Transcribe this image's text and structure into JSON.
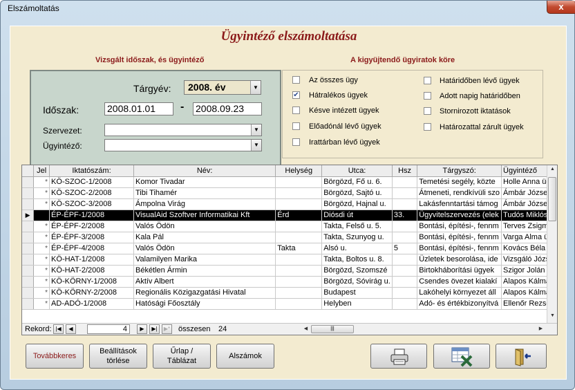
{
  "window": {
    "title": "Elszámoltatás",
    "close": "x"
  },
  "heading": "Ügyintéző elszámoltatása",
  "left_section": {
    "label": "Vizsgált időszak, és ügyintéző",
    "year_label": "Tárgyév:",
    "year_value": "2008. év",
    "period_label": "Időszak:",
    "period_from": "2008.01.01",
    "period_dash": "-",
    "period_to": "2008.09.23",
    "org_label": "Szervezet:",
    "org_value": "",
    "clerk_label": "Ügyintéző:",
    "clerk_value": ""
  },
  "right_section": {
    "label": "A kigyüjtendő ügyiratok köre",
    "options": [
      {
        "label": "Az összes ügy",
        "checked": false
      },
      {
        "label": "Hátralékos ügyek",
        "checked": true
      },
      {
        "label": "Késve intézett ügyek",
        "checked": false
      },
      {
        "label": "Előadónál lévő ügyek",
        "checked": false
      },
      {
        "label": "Irattárban lévő ügyek",
        "checked": false
      },
      {
        "label": "Határidőben lévő ügyek",
        "checked": false
      },
      {
        "label": "Adott napig határidőben",
        "checked": false
      },
      {
        "label": "Stornirozott iktatások",
        "checked": false
      },
      {
        "label": "Határozattal zárult ügyek",
        "checked": false
      }
    ]
  },
  "grid": {
    "columns": [
      "Jel",
      "Iktatószám:",
      "Név:",
      "Helység",
      "Utca:",
      "Hsz",
      "Tárgyszó:",
      "Ügyintéző"
    ],
    "rows": [
      [
        "*",
        "KÖ-SZOC-1/2008",
        "Komor Tivadar",
        "",
        "Börgözd, Fő u. 6.",
        "",
        "Temetési segély, közte",
        "Holle Anna ügy"
      ],
      [
        "*",
        "KÖ-SZOC-2/2008",
        "Tibi Tihamér",
        "",
        "Börgözd, Sajtó u.",
        "",
        "Átmeneti, rendkívüli szo",
        "Ámbár József"
      ],
      [
        "*",
        "KÖ-SZOC-3/2008",
        "Ámpolna Virág",
        "",
        "Börgözd, Hajnal u.",
        "",
        "Lakásfenntartási támog",
        "Ámbár József"
      ],
      [
        "",
        "ÉP-ÉPF-1/2008",
        "VisualAid Szoftver Informatikai Kft",
        "Érd",
        "Diósdi út",
        "33.",
        "Ügyvitelszervezés (elek",
        "Tudós Miklós"
      ],
      [
        "*",
        "ÉP-ÉPF-2/2008",
        "Valós Ödön",
        "",
        "Takta, Felső u. 5.",
        "",
        "Bontási, építési-, fennm",
        "Terves Zsigm"
      ],
      [
        "*",
        "ÉP-ÉPF-3/2008",
        "Kala Pál",
        "",
        "Takta, Szunyog u.",
        "",
        "Bontási, építési-, fennm",
        "Varga Alma ü"
      ],
      [
        "*",
        "ÉP-ÉPF-4/2008",
        "Valós Ödön",
        "Takta",
        "Alsó u.",
        "5",
        "Bontási, építési-, fennm",
        "Kovács Béla"
      ],
      [
        "*",
        "KÖ-HAT-1/2008",
        "Valamilyen Marika",
        "",
        "Takta, Boltos u. 8.",
        "",
        "Üzletek besorolása, ide",
        "Vizsgáló Józs"
      ],
      [
        "*",
        "KÖ-HAT-2/2008",
        "Békétlen Ármin",
        "",
        "Börgözd, Szomszé",
        "",
        "Birtokháborítási ügyek",
        "Szigor Jolán ü"
      ],
      [
        "*",
        "KÖ-KÖRNY-1/2008",
        "Aktív Albert",
        "",
        "Börgözd, Sóvirág u.",
        "",
        "Csendes övezet kialakí",
        "Alapos Kálmá"
      ],
      [
        "*",
        "KÖ-KÖRNY-2/2008",
        "Regionális Közigazgatási Hivatal",
        "",
        "Budapest",
        "",
        "Lakóhelyi környezet áll",
        "Alapos Kálmá"
      ],
      [
        "*",
        "AD-ADÓ-1/2008",
        "Hatósági Főosztály",
        "",
        "Helyben",
        "",
        "Adó- és értékbizonyítvá",
        "Ellenőr Rezső"
      ]
    ],
    "selected_row": 3,
    "record_label": "Rekord:",
    "record_current": "4",
    "record_total_label": "összesen",
    "record_total": "24"
  },
  "buttons": {
    "search_more": "Továbbkeres",
    "reset_settings": "Beállítások törlése",
    "form_table": "Űrlap / Táblázat",
    "subtotals": "Alszámok"
  },
  "icons": [
    "printer-icon",
    "export-icon",
    "exit-icon"
  ]
}
